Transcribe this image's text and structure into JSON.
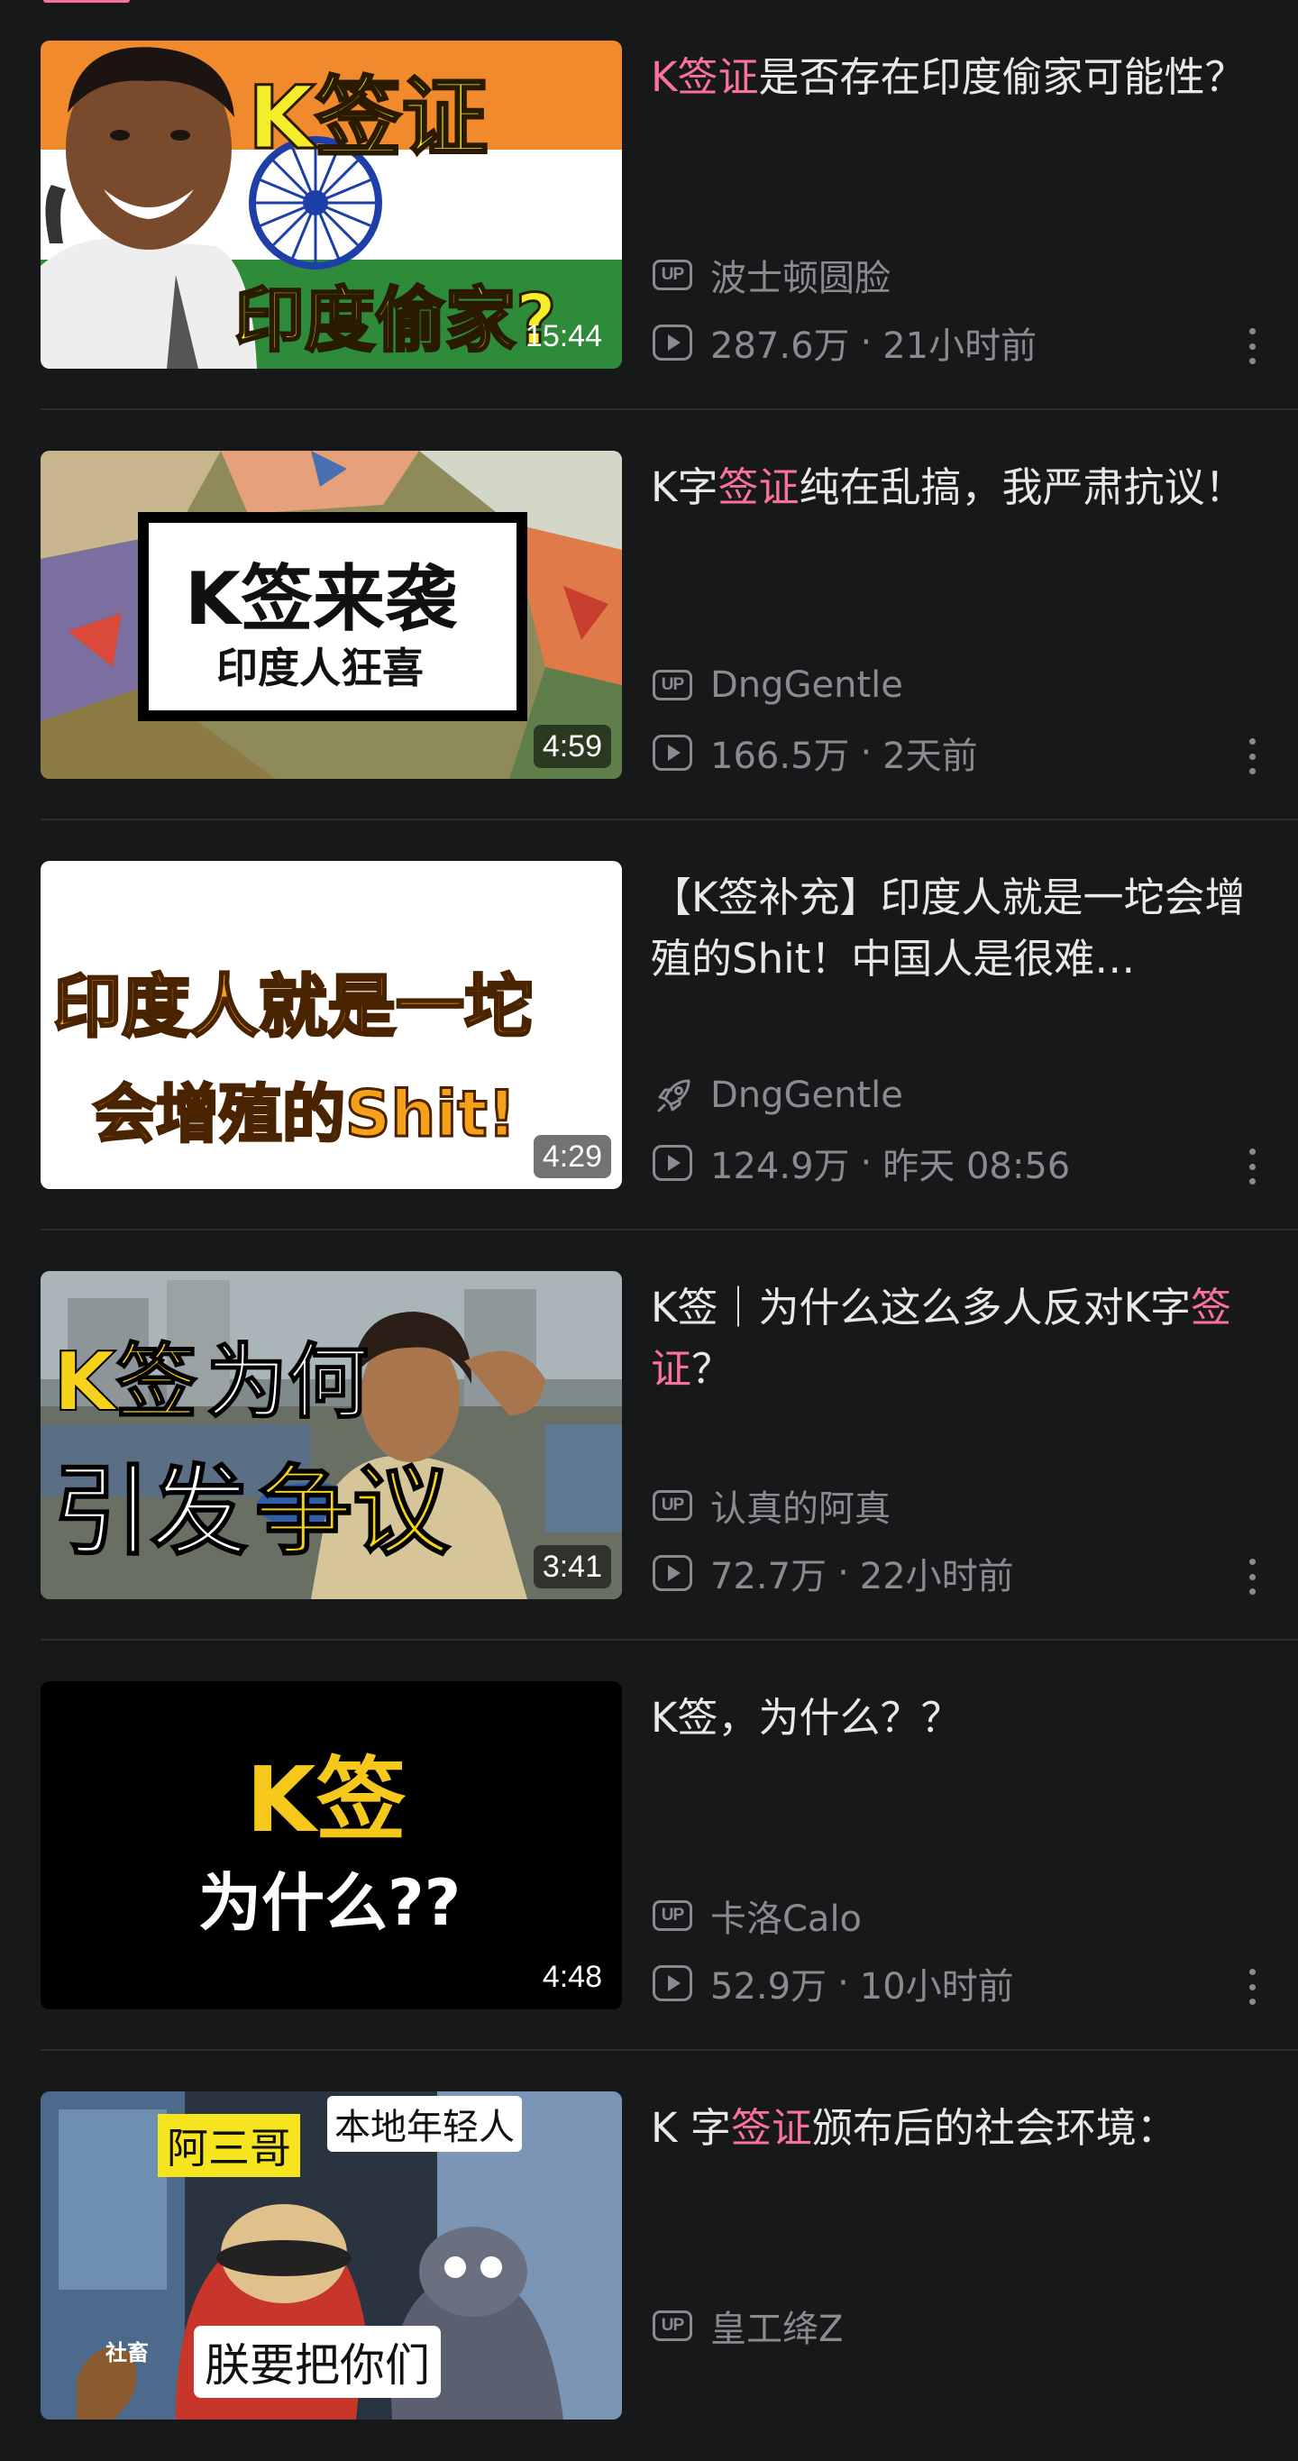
{
  "videos": [
    {
      "title_parts": [
        {
          "t": "K签证",
          "hl": true
        },
        {
          "t": "是否存在印度偷家可能性？",
          "hl": false
        }
      ],
      "uploader": "波士顿圆脸",
      "views": "287.6万",
      "time": "21小时前",
      "duration": "15:44",
      "uploader_icon": "up-icon",
      "thumb_text": [
        "K签证",
        "印度偷家?"
      ]
    },
    {
      "title_parts": [
        {
          "t": "K字",
          "hl": false
        },
        {
          "t": "签证",
          "hl": true
        },
        {
          "t": "纯在乱搞，我严肃抗议！",
          "hl": false
        }
      ],
      "uploader": "DngGentle",
      "views": "166.5万",
      "time": "2天前",
      "duration": "4:59",
      "uploader_icon": "up-icon",
      "thumb_text": [
        "K签来袭",
        "印度人狂喜"
      ]
    },
    {
      "title_parts": [
        {
          "t": "【K签补充】印度人就是一坨会增殖的Shit！中国人是很难…",
          "hl": false
        }
      ],
      "uploader": "DngGentle",
      "views": "124.9万",
      "time": "昨天 08:56",
      "duration": "4:29",
      "uploader_icon": "rocket-icon",
      "thumb_text": [
        "印度人就是一坨",
        "会增殖的Shit!"
      ]
    },
    {
      "title_parts": [
        {
          "t": "K签｜为什么这么多人反对K字",
          "hl": false
        },
        {
          "t": "签证",
          "hl": true
        },
        {
          "t": "？",
          "hl": false
        }
      ],
      "uploader": "认真的阿真",
      "views": "72.7万",
      "time": "22小时前",
      "duration": "3:41",
      "uploader_icon": "up-icon",
      "thumb_text": [
        "K签",
        "为何",
        "引发",
        "争议"
      ]
    },
    {
      "title_parts": [
        {
          "t": "K签，为什么？？",
          "hl": false
        }
      ],
      "uploader": "卡洛Calo",
      "views": "52.9万",
      "time": "10小时前",
      "duration": "4:48",
      "uploader_icon": "up-icon",
      "thumb_text": [
        "K签",
        "为什么??"
      ]
    },
    {
      "title_parts": [
        {
          "t": "K 字",
          "hl": false
        },
        {
          "t": "签证",
          "hl": true
        },
        {
          "t": "颁布后的社会环境：",
          "hl": false
        }
      ],
      "uploader": "皇工绛Z",
      "uploader_icon": "up-icon",
      "thumb_text": [
        "阿三哥",
        "本地年轻人",
        "朕要把你们",
        "社畜"
      ]
    }
  ],
  "ui": {
    "up_label": "UP",
    "separator": "·"
  },
  "colors": {
    "highlight": "#fb7299",
    "background": "#17181a",
    "meta": "#8a8b8f"
  }
}
